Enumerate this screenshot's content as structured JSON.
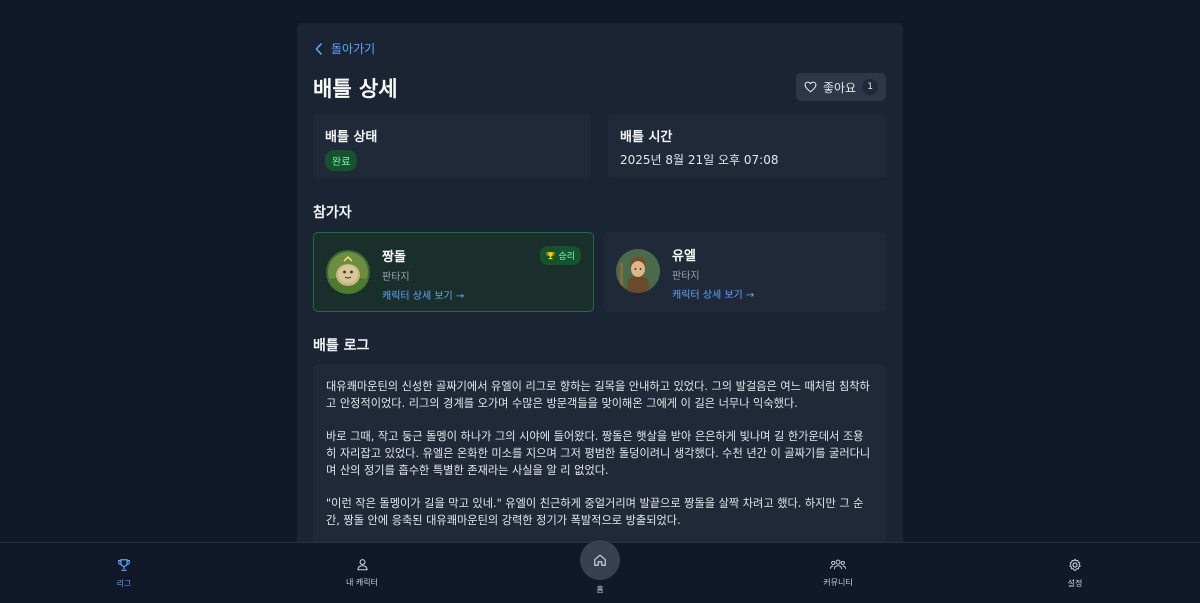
{
  "back_label": "돌아가기",
  "page_title": "배틀 상세",
  "like": {
    "label": "좋아요",
    "count": "1"
  },
  "battle_status": {
    "label": "배틀 상태",
    "value": "완료"
  },
  "battle_time": {
    "label": "배틀 시간",
    "value": "2025년 8월 21일 오후 07:08"
  },
  "participants_heading": "참가자",
  "participants": [
    {
      "name": "짱돌",
      "world": "판타지",
      "link": "캐릭터 상세 보기 →",
      "result": "승리"
    },
    {
      "name": "유엘",
      "world": "판타지",
      "link": "캐릭터 상세 보기 →"
    }
  ],
  "log_heading": "배틀 로그",
  "log_paragraphs": [
    "대유쾌마운틴의 신성한 골짜기에서 유엘이 리그로 향하는 길목을 안내하고 있었다. 그의 발걸음은 여느 때처럼 침착하고 안정적이었다. 리그의 경계를 오가며 수많은 방문객들을 맞이해온 그에게 이 길은 너무나 익숙했다.",
    "바로 그때, 작고 둥근 돌멩이 하나가 그의 시야에 들어왔다. 짱돌은 햇살을 받아 은은하게 빛나며 길 한가운데서 조용히 자리잡고 있었다. 유엘은 온화한 미소를 지으며 그저 평범한 돌덩이려니 생각했다. 수천 년간 이 골짜기를 굴러다니며 산의 정기를 흡수한 특별한 존재라는 사실을 알 리 없었다.",
    "\"이런 작은 돌멩이가 길을 막고 있네.\" 유엘이 친근하게 중얼거리며 발끝으로 짱돌을 살짝 차려고 했다. 하지만 그 순간, 짱돌 안에 응축된 대유쾌마운틴의 강력한 정기가 폭발적으로 방출되었다."
  ],
  "nav": {
    "league": "리그",
    "my_character": "내 캐릭터",
    "home": "홈",
    "community": "커뮤니티",
    "settings": "설정"
  },
  "colors": {
    "accent": "#60a5fa",
    "win_badge": "#14532d",
    "background": "#111827"
  }
}
